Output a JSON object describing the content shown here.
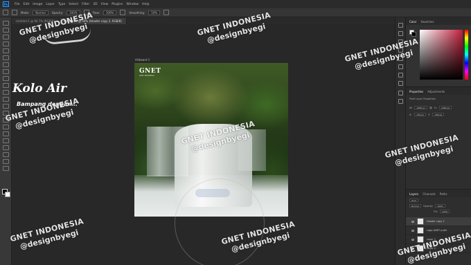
{
  "menubar": {
    "items": [
      "File",
      "Edit",
      "Image",
      "Layer",
      "Type",
      "Select",
      "Filter",
      "3D",
      "View",
      "Plugins",
      "Window",
      "Help"
    ]
  },
  "options": {
    "mode_label": "Mode:",
    "mode_value": "Normal",
    "opacity_label": "Opacity:",
    "opacity_value": "100%",
    "flow_label": "Flow:",
    "flow_value": "100%",
    "smoothing_label": "Smoothing:",
    "smoothing_value": "10%"
  },
  "tabs": [
    {
      "label": "Untitled-1 @ 66.7% (RGB/8)",
      "active": false
    },
    {
      "label": "Untitled-2 @ 50% (Header copy 2, RGB/8)",
      "active": true
    }
  ],
  "canvas": {
    "artboard_label": "Artboard 1",
    "logo": "GNET",
    "logo_sub": "GNET INDONESIA",
    "script_title": "Kolo Air",
    "script_sub": "Bampang dengan..."
  },
  "panels": {
    "color_tabs": [
      "Color",
      "Swatches"
    ],
    "props_tabs": [
      "Properties",
      "Adjustments"
    ],
    "props_kind": "Pixel Layer Properties",
    "w_label": "W:",
    "w_value": "1080 px",
    "h_label": "H:",
    "h_value": "1080 px",
    "x_label": "X:",
    "x_value": "-150 px",
    "y_label": "Y:",
    "y_value": "-300 px",
    "layers_tabs": [
      "Layers",
      "Channels",
      "Paths"
    ],
    "kind_label": "Kind",
    "blend_mode": "Normal",
    "opacity_label": "Opacity:",
    "opacity_value": "100%",
    "fill_label": "Fill:",
    "fill_value": "100%",
    "layers": [
      {
        "name": "Header copy 2",
        "selected": true
      },
      {
        "name": "Logo GNET putih",
        "selected": false
      },
      {
        "name": "Layer 1",
        "selected": false
      },
      {
        "name": "Layer 2",
        "selected": false
      }
    ]
  },
  "watermark": {
    "line1": "GNET INDONESIA",
    "line2": "@designbyegi"
  }
}
